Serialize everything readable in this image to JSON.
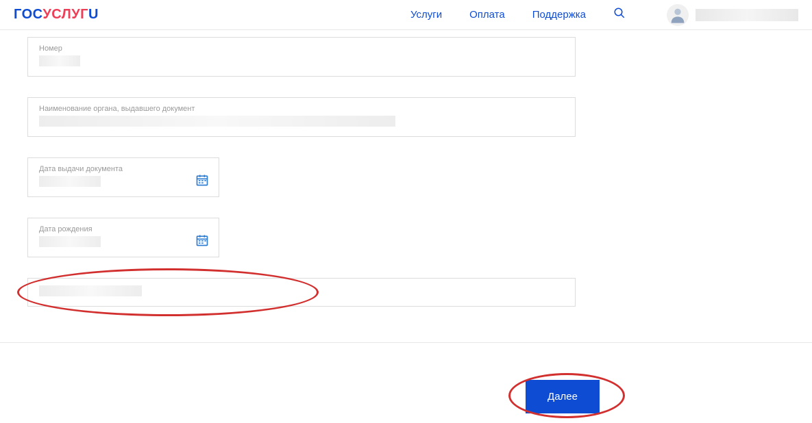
{
  "header": {
    "logo_part1": "ГОС",
    "logo_part2": "УСЛУГ",
    "logo_part3": "U",
    "nav": {
      "services": "Услуги",
      "payment": "Оплата",
      "support": "Поддержка"
    }
  },
  "form": {
    "number_label": "Номер",
    "issuer_label": "Наименование органа, выдавшего документ",
    "issue_date_label": "Дата выдачи документа",
    "birth_date_label": "Дата рождения"
  },
  "footer": {
    "next_button": "Далее"
  }
}
